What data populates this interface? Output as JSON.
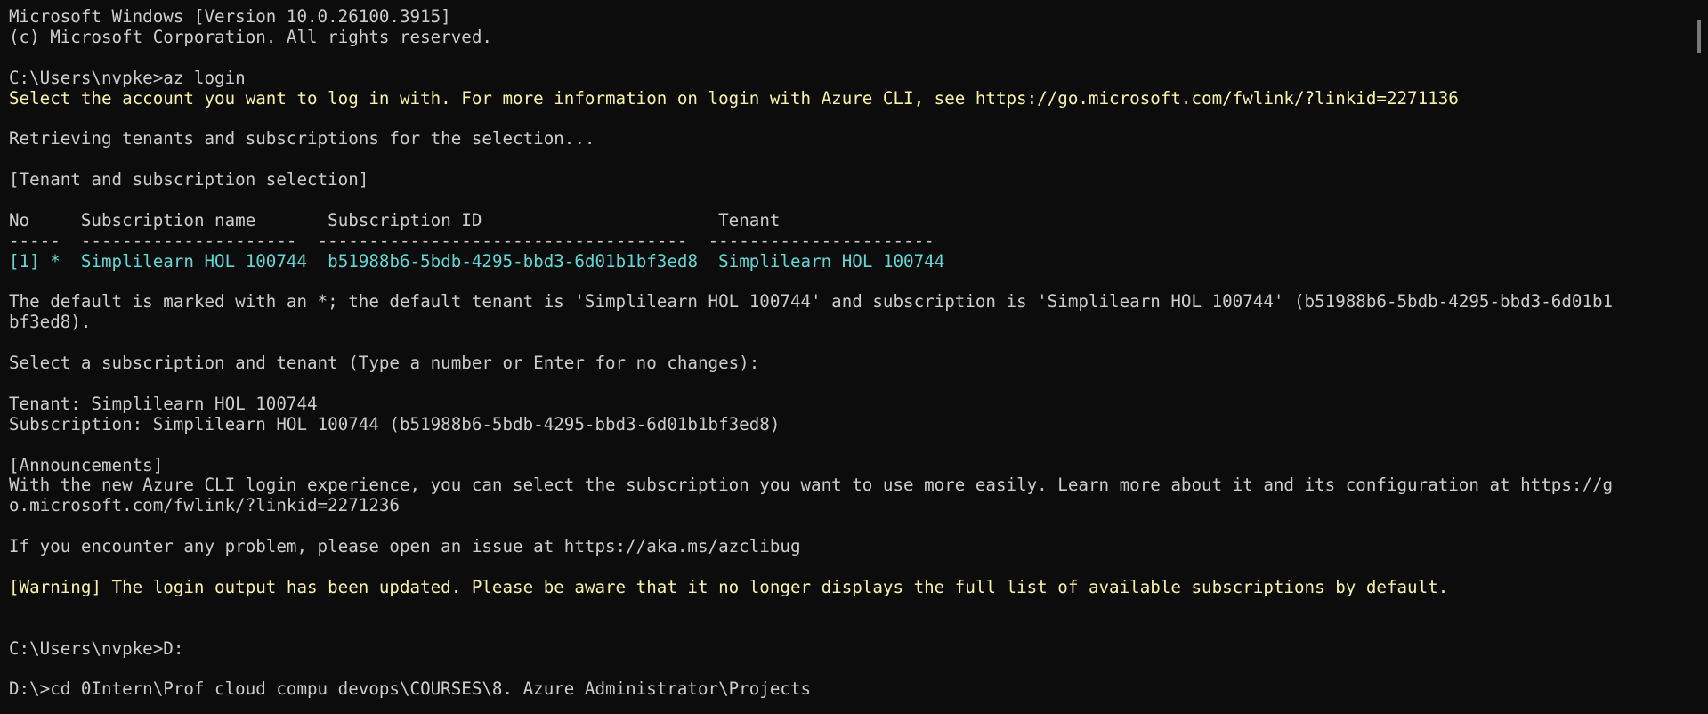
{
  "terminal": {
    "header_line1": "Microsoft Windows [Version 10.0.26100.3915]",
    "header_line2": "(c) Microsoft Corporation. All rights reserved.",
    "prompt1": "C:\\Users\\nvpke>az login",
    "select_account": "Select the account you want to log in with. For more information on login with Azure CLI, see https://go.microsoft.com/fwlink/?linkid=2271136",
    "retrieving": "Retrieving tenants and subscriptions for the selection...",
    "selection_header": "[Tenant and subscription selection]",
    "table": {
      "col_no": "No",
      "col_sub_name": "Subscription name",
      "col_sub_id": "Subscription ID",
      "col_tenant": "Tenant",
      "sep_no": "-----",
      "sep_sub_name": "---------------------",
      "sep_sub_id": "------------------------------------",
      "sep_tenant": "----------------------",
      "row_no": "[1] *",
      "row_sub_name": "Simplilearn HOL 100744",
      "row_sub_id": "b51988b6-5bdb-4295-bbd3-6d01b1bf3ed8",
      "row_tenant": "Simplilearn HOL 100744"
    },
    "default_info_1": "The default is marked with an *; the default tenant is 'Simplilearn HOL 100744' and subscription is 'Simplilearn HOL 100744' (b51988b6-5bdb-4295-bbd3-6d01b1",
    "default_info_2": "bf3ed8).",
    "select_prompt": "Select a subscription and tenant (Type a number or Enter for no changes):",
    "tenant_line": "Tenant: Simplilearn HOL 100744",
    "subscription_line": "Subscription: Simplilearn HOL 100744 (b51988b6-5bdb-4295-bbd3-6d01b1bf3ed8)",
    "announcements_header": "[Announcements]",
    "announcement_1": "With the new Azure CLI login experience, you can select the subscription you want to use more easily. Learn more about it and its configuration at https://g",
    "announcement_2": "o.microsoft.com/fwlink/?linkid=2271236",
    "issue_line": "If you encounter any problem, please open an issue at https://aka.ms/azclibug",
    "warning_line": "[Warning] The login output has been updated. Please be aware that it no longer displays the full list of available subscriptions by default.",
    "prompt2": "C:\\Users\\nvpke>D:",
    "prompt3": "D:\\>cd 0Intern\\Prof cloud compu devops\\COURSES\\8. Azure Administrator\\Projects"
  },
  "colors": {
    "background": "#0c0c0c",
    "default_text": "#cccccc",
    "yellow_text": "#f9f1a5",
    "cyan_text": "#61d6d6"
  }
}
